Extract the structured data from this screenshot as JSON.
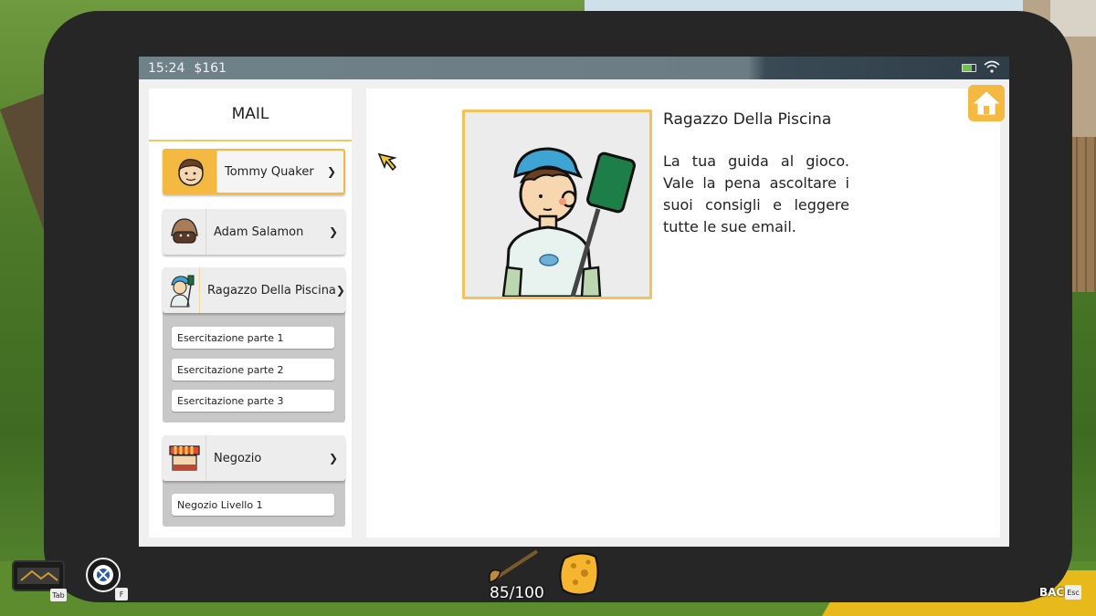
{
  "status": {
    "time": "15:24",
    "money": "$161"
  },
  "mail": {
    "title": "MAIL",
    "contacts": [
      {
        "name": "Tommy Quaker",
        "icon": "tommy-avatar-icon"
      },
      {
        "name": "Adam Salamon",
        "icon": "adam-avatar-icon"
      },
      {
        "name": "Ragazzo Della Piscina",
        "icon": "pool-boy-avatar-icon",
        "messages": [
          "Esercitazione parte 1",
          "Esercitazione parte 2",
          "Esercitazione parte 3"
        ]
      },
      {
        "name": "Negozio",
        "icon": "shop-icon",
        "messages": [
          "Negozio Livello 1"
        ]
      }
    ]
  },
  "detail": {
    "name": "Ragazzo Della Piscina",
    "description": "La tua guida al gioco. Vale la pena ascoltare i suoi consigli e leggere tutte le sue email."
  },
  "hud": {
    "camera_key": "Tab",
    "vision_key": "F",
    "tool_count": "85/100",
    "back_label": "BACK",
    "back_key": "Esc"
  },
  "colors": {
    "accent": "#f3b940",
    "statusbar": "#6f8189"
  }
}
